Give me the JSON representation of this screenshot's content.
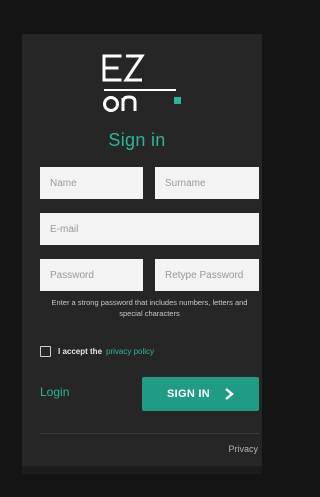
{
  "brand": {
    "logo_line1": "EZ",
    "logo_line2": "on",
    "accent": "#2bb59a",
    "button_color": "#1f9c83"
  },
  "form": {
    "title": "Sign in",
    "name_placeholder": "Name",
    "surname_placeholder": "Surname",
    "email_placeholder": "E-mail",
    "password_placeholder": "Password",
    "retype_placeholder": "Retype Password",
    "password_hint": "Enter a strong password that includes numbers, letters and special characters",
    "accept_text": "I accept the",
    "privacy_policy_link": "privacy policy",
    "accept_checked": false,
    "login_link": "Login",
    "signin_button": "SIGN IN",
    "signin_icon": "chevron-right-icon"
  },
  "footer": {
    "privacy_link": "Privacy"
  }
}
